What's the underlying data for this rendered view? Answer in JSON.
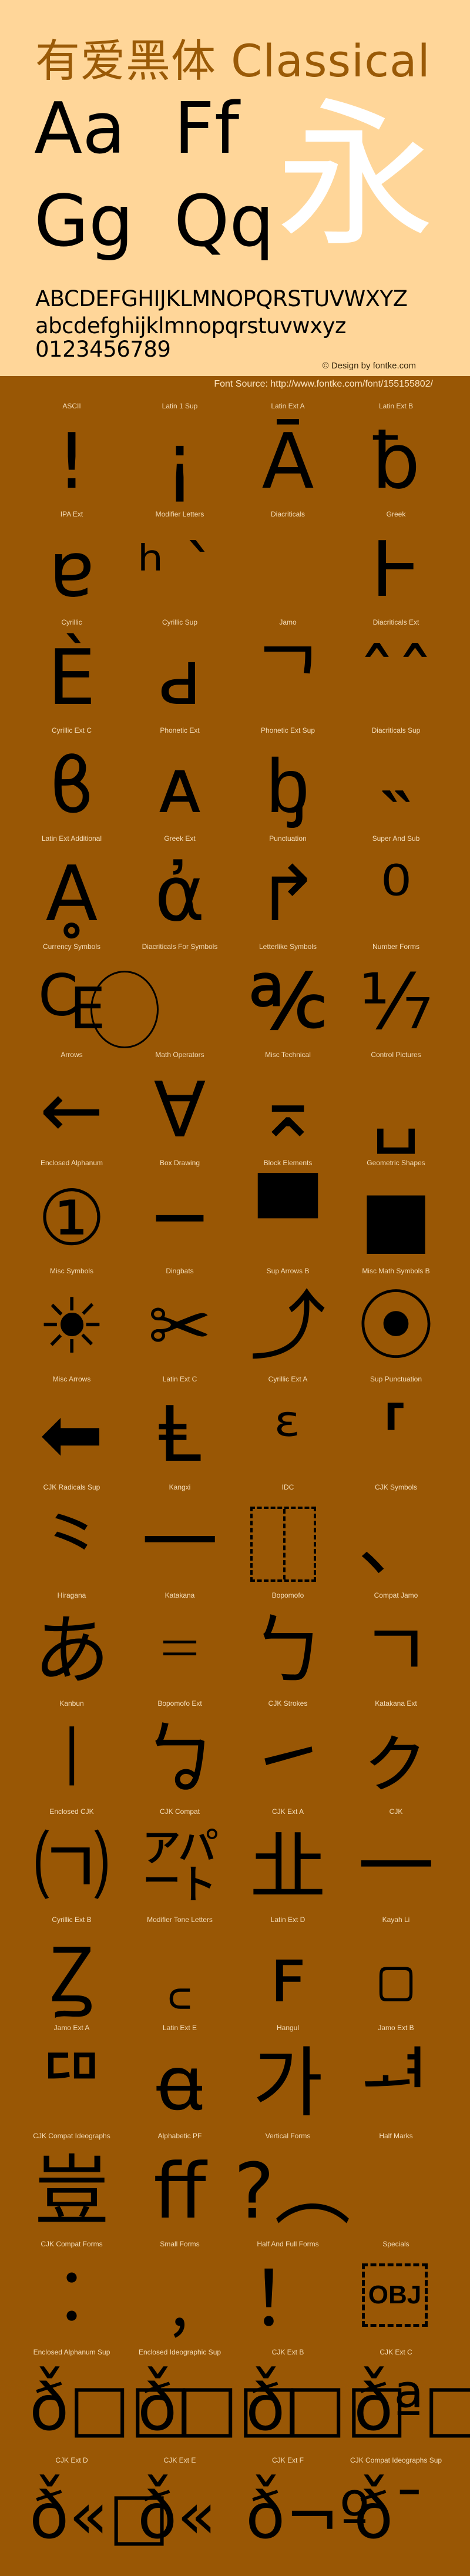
{
  "header": {
    "title": "有爱黑体 Classical",
    "sample_pairs": [
      "Aa",
      "Ff",
      "Gg",
      "Qq"
    ],
    "hero_glyph": "永",
    "uppercase": "ABCDEFGHIJKLMNOPQRSTUVWXYZ",
    "lowercase": "abcdefghijklmnopqrstuvwxyz",
    "digits": "0123456789",
    "copyright": "© Design by fontke.com",
    "font_source": "Font Source: http://www.fontke.com/font/155155802/"
  },
  "colors": {
    "header_bg": "#FFD699",
    "page_bg": "#995705",
    "title": "#9A5A07",
    "hero_glyph": "#FFFFFF",
    "label": "#F5DDB8"
  },
  "blocks": [
    {
      "label": "ASCII",
      "glyph": "!"
    },
    {
      "label": "Latin 1 Sup",
      "glyph": "¡"
    },
    {
      "label": "Latin Ext A",
      "glyph": "Ā"
    },
    {
      "label": "Latin Ext B",
      "glyph": "ƀ"
    },
    {
      "label": "IPA Ext",
      "glyph": "ɐ"
    },
    {
      "label": "Modifier Letters",
      "glyph": "ʰ ˋ"
    },
    {
      "label": "Diacriticals",
      "glyph": ""
    },
    {
      "label": "Greek",
      "glyph": "Ͱ"
    },
    {
      "label": "Cyrillic",
      "glyph": "Ѐ"
    },
    {
      "label": "Cyrillic Sup",
      "glyph": "ԁ"
    },
    {
      "label": "Jamo",
      "glyph": "ᄀ"
    },
    {
      "label": "Diacriticals Ext",
      "glyph": "ˆˆ"
    },
    {
      "label": "Cyrillic Ext C",
      "glyph": "ϐ"
    },
    {
      "label": "Phonetic Ext",
      "glyph": "ᴀ"
    },
    {
      "label": "Phonetic Ext Sup",
      "glyph": "ᶀ"
    },
    {
      "label": "Diacriticals Sup",
      "glyph": "˵"
    },
    {
      "label": "Latin Ext Additional",
      "glyph": "Ḁ"
    },
    {
      "label": "Greek Ext",
      "glyph": "ἀ"
    },
    {
      "label": "Punctuation",
      "glyph": "↱"
    },
    {
      "label": "Super And Sub",
      "glyph": "⁰"
    },
    {
      "label": "Currency Symbols",
      "glyph": "₠"
    },
    {
      "label": "Diacriticals For Symbols",
      "glyph": ""
    },
    {
      "label": "Letterlike Symbols",
      "glyph": "℀"
    },
    {
      "label": "Number Forms",
      "glyph": "⅐"
    },
    {
      "label": "Arrows",
      "glyph": "←"
    },
    {
      "label": "Math Operators",
      "glyph": "∀"
    },
    {
      "label": "Misc Technical",
      "glyph": "⌅"
    },
    {
      "label": "Control Pictures",
      "glyph": "␣"
    },
    {
      "label": "Enclosed Alphanum",
      "glyph": "①"
    },
    {
      "label": "Box Drawing",
      "glyph": "─"
    },
    {
      "label": "Block Elements",
      "glyph": "▀"
    },
    {
      "label": "Geometric Shapes",
      "glyph": "■"
    },
    {
      "label": "Misc Symbols",
      "glyph": "☀"
    },
    {
      "label": "Dingbats",
      "glyph": "✂"
    },
    {
      "label": "Sup Arrows B",
      "glyph": "⤴"
    },
    {
      "label": "Misc Math Symbols B",
      "glyph": "⦿"
    },
    {
      "label": "Misc Arrows",
      "glyph": "⬅"
    },
    {
      "label": "Latin Ext C",
      "glyph": "Ⱡ"
    },
    {
      "label": "Cyrillic Ext A",
      "glyph": "ᵋ"
    },
    {
      "label": "Sup Punctuation",
      "glyph": "⸢"
    },
    {
      "label": "CJK Radicals Sup",
      "glyph": "⺀"
    },
    {
      "label": "Kangxi",
      "glyph": "⼀"
    },
    {
      "label": "IDC",
      "glyph": ""
    },
    {
      "label": "CJK Symbols",
      "glyph": "、"
    },
    {
      "label": "Hiragana",
      "glyph": "あ"
    },
    {
      "label": "Katakana",
      "glyph": "゠"
    },
    {
      "label": "Bopomofo",
      "glyph": "ㄅ"
    },
    {
      "label": "Compat Jamo",
      "glyph": "ㄱ"
    },
    {
      "label": "Kanbun",
      "glyph": "㆐"
    },
    {
      "label": "Bopomofo Ext",
      "glyph": "ㆠ"
    },
    {
      "label": "CJK Strokes",
      "glyph": "㇀"
    },
    {
      "label": "Katakana Ext",
      "glyph": "ㇰ"
    },
    {
      "label": "Enclosed CJK",
      "glyph": "㈀"
    },
    {
      "label": "CJK Compat",
      "glyph": "㌀"
    },
    {
      "label": "CJK Ext A",
      "glyph": "㐀"
    },
    {
      "label": "CJK",
      "glyph": "一"
    },
    {
      "label": "Cyrillic Ext B",
      "glyph": "Ꙁ"
    },
    {
      "label": "Modifier Tone Letters",
      "glyph": "꜀"
    },
    {
      "label": "Latin Ext D",
      "glyph": "ꜰ"
    },
    {
      "label": "Kayah Li",
      "glyph": "꤀"
    },
    {
      "label": "Jamo Ext A",
      "glyph": "ꥠ"
    },
    {
      "label": "Latin Ext E",
      "glyph": "ꬰ"
    },
    {
      "label": "Hangul",
      "glyph": "가"
    },
    {
      "label": "Jamo Ext B",
      "glyph": "ힰ"
    },
    {
      "label": "CJK Compat Ideographs",
      "glyph": "豈"
    },
    {
      "label": "Alphabetic PF",
      "glyph": "ﬀ"
    },
    {
      "label": "Vertical Forms",
      "glyph": "?︵"
    },
    {
      "label": "Half Marks",
      "glyph": ""
    },
    {
      "label": "CJK Compat Forms",
      "glyph": "︰"
    },
    {
      "label": "Small Forms",
      "glyph": "﹐"
    },
    {
      "label": "Half And Full Forms",
      "glyph": "！"
    },
    {
      "label": "Specials",
      "glyph": "OBJ"
    },
    {
      "label": "Enclosed Alphanum Sup",
      "glyph": "ð̌□□"
    },
    {
      "label": "Enclosed Ideographic Sup",
      "glyph": "ð̌□□"
    },
    {
      "label": "CJK Ext B",
      "glyph": "ð̌□□"
    },
    {
      "label": "CJK Ext C",
      "glyph": "ð̌ª□"
    },
    {
      "label": "CJK Ext D",
      "glyph": "ð̌«□"
    },
    {
      "label": "CJK Ext E",
      "glyph": "ð̌«"
    },
    {
      "label": "CJK Ext F",
      "glyph": "ð̌¬º"
    },
    {
      "label": "CJK Compat Ideographs Sup",
      "glyph": "ð̌¯"
    }
  ]
}
